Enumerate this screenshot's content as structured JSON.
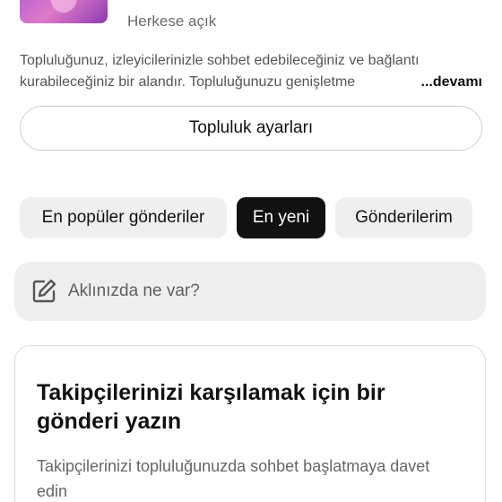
{
  "community": {
    "privacy": "Herkese açık",
    "description_line1": "Topluluğunuz, izleyicilerinizle sohbet edebileceğiniz ve bağlantı",
    "description_line2": "kurabileceğiniz bir alandır. Topluluğunuzu genişletme",
    "more_label": " ...devamı"
  },
  "settings_button": {
    "label": "Topluluk ayarları"
  },
  "tabs": [
    {
      "label": "En popüler gönderiler",
      "active": false
    },
    {
      "label": "En yeni",
      "active": true
    },
    {
      "label": "Gönderilerim",
      "active": false
    }
  ],
  "compose": {
    "placeholder": "Aklınızda ne var?",
    "icon": "edit-icon"
  },
  "welcome_card": {
    "title": "Takipçilerinizi karşılamak için bir gönderi yazın",
    "body": "Takipçilerinizi topluluğunuzda sohbet başlatmaya davet edin"
  },
  "colors": {
    "active_tab_bg": "#111111",
    "chip_bg": "#efefef",
    "muted_text": "#6b6b6b"
  }
}
